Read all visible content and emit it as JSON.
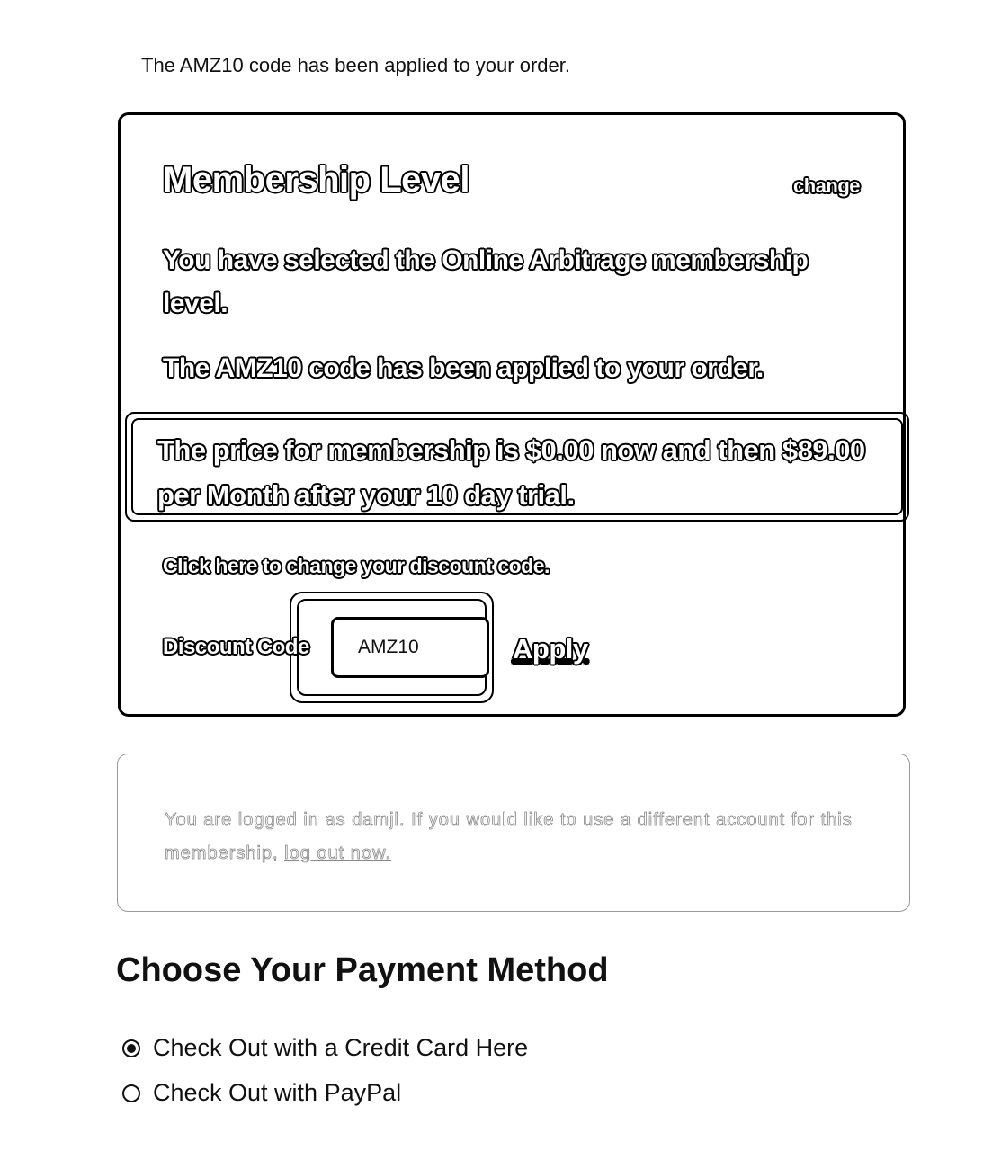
{
  "top_notice": "The AMZ10 code has been applied to your order.",
  "membership": {
    "title": "Membership Level",
    "change_label": "change",
    "selected_prefix": "You have selected the ",
    "level_name": "Online Arbitrage",
    "selected_suffix": " membership level.",
    "applied_text": "The AMZ10 code has been applied to your order.",
    "price_text": "The price for membership is $0.00 now and then $89.00 per Month after your 10 day trial.",
    "change_discount_link": "Click here to change your discount code.",
    "discount_label": "Discount Code",
    "discount_value": "AMZ10",
    "apply_label": "Apply"
  },
  "login_notice": {
    "text": "You are logged in as damjl. If you would like to use a different account for this membership, ",
    "logout_link": "log out now."
  },
  "payment": {
    "heading": "Choose Your Payment Method",
    "options": [
      {
        "label": "Check Out with a Credit Card Here",
        "selected": true
      },
      {
        "label": "Check Out with PayPal",
        "selected": false
      }
    ]
  }
}
